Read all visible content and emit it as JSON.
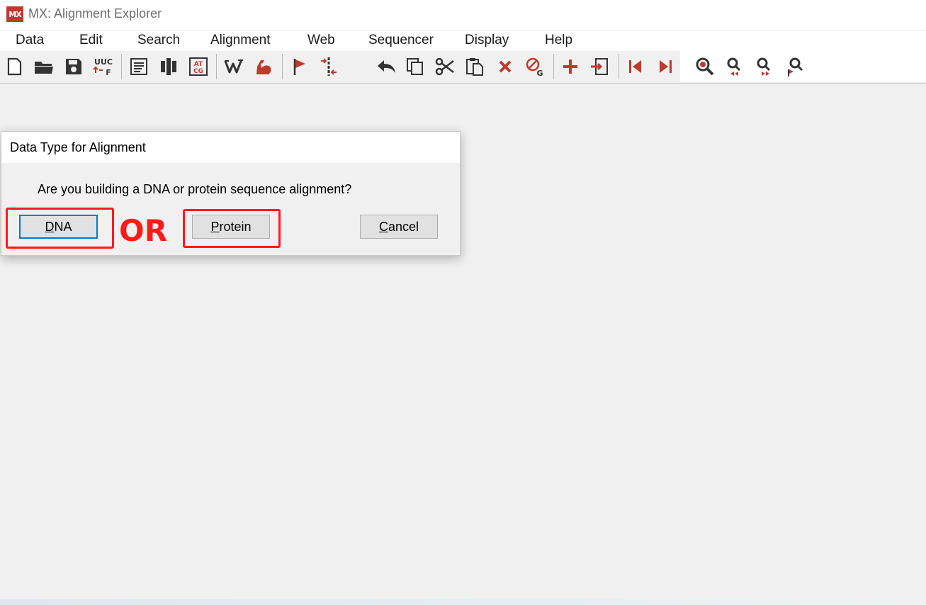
{
  "window": {
    "logo_text": "MX",
    "title": "MX: Alignment Explorer"
  },
  "menu": [
    {
      "label": "Data"
    },
    {
      "label": "Edit"
    },
    {
      "label": "Search"
    },
    {
      "label": "Alignment"
    },
    {
      "label": "Web"
    },
    {
      "label": "Sequencer"
    },
    {
      "label": "Display"
    },
    {
      "label": "Help"
    }
  ],
  "toolbar": {
    "uuc_text_top": "UUC",
    "uuc_text_bottom": "F",
    "atcg_text_top": "AT",
    "atcg_text_bottom": "CG",
    "gap_letter": "G",
    "accent_color": "#c0392b",
    "icon_color": "#333333"
  },
  "dialog": {
    "title": "Data Type for Alignment",
    "message": "Are you building a DNA or protein sequence alignment?",
    "buttons": {
      "dna": {
        "accel": "D",
        "rest": "NA"
      },
      "protein": {
        "accel": "P",
        "rest": "rotein"
      },
      "cancel": {
        "accel": "C",
        "rest": "ancel"
      }
    }
  },
  "annotation": {
    "text": "OR",
    "color": "#ff1a1a"
  }
}
